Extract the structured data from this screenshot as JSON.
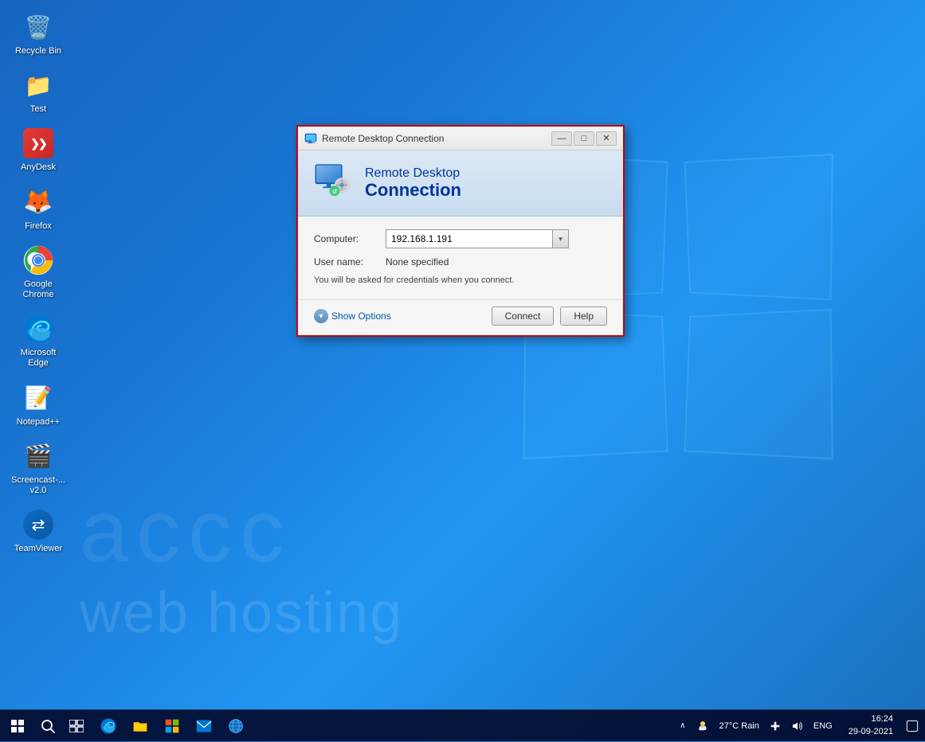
{
  "desktop": {
    "icons": [
      {
        "id": "recycle-bin",
        "label": "Recycle Bin",
        "emoji": "🗑️"
      },
      {
        "id": "test",
        "label": "Test",
        "emoji": "📁"
      },
      {
        "id": "anydesk",
        "label": "AnyDesk",
        "emoji": "❯❯"
      },
      {
        "id": "firefox",
        "label": "Firefox",
        "emoji": "🦊"
      },
      {
        "id": "google-chrome",
        "label": "Google Chrome",
        "emoji": "⬤"
      },
      {
        "id": "microsoft-edge",
        "label": "Microsoft Edge",
        "emoji": "◉"
      },
      {
        "id": "notepadpp",
        "label": "Notepad++",
        "emoji": "📝"
      },
      {
        "id": "screencast",
        "label": "Screencast-...\nv2.0",
        "emoji": "🎬"
      },
      {
        "id": "teamviewer",
        "label": "TeamViewer",
        "emoji": "⇄"
      }
    ],
    "watermark_top": "accc",
    "watermark_bottom": "web hosting"
  },
  "rdc_dialog": {
    "title": "Remote Desktop Connection",
    "header_line1": "Remote Desktop",
    "header_line2": "Connection",
    "computer_label": "Computer:",
    "computer_value": "192.168.1.191",
    "username_label": "User name:",
    "username_value": "None specified",
    "info_text": "You will be asked for credentials when you connect.",
    "show_options_label": "Show Options",
    "connect_btn": "Connect",
    "help_btn": "Help",
    "minimize_btn": "—",
    "maximize_btn": "□",
    "close_btn": "✕"
  },
  "taskbar": {
    "start_icon": "⊞",
    "search_icon": "○",
    "task_view_icon": "▣",
    "edge_icon": "◉",
    "explorer_icon": "📁",
    "store_icon": "🪟",
    "mail_icon": "✉",
    "globe_icon": "🌐",
    "weather": "27°C  Rain",
    "tray_icons": [
      "∧",
      "🌤",
      "🔊"
    ],
    "lang": "ENG",
    "time": "16:24",
    "date": "29-09-2021",
    "notification_icon": "🗨"
  }
}
